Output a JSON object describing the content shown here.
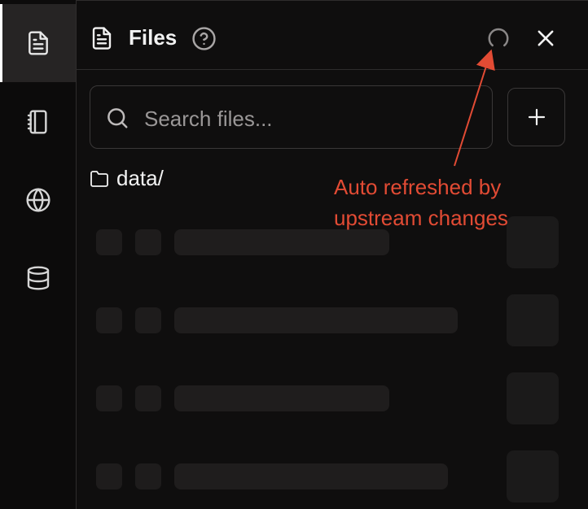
{
  "rail": {
    "items": [
      {
        "name": "files",
        "icon": "file-text-icon",
        "active": true
      },
      {
        "name": "notebook",
        "icon": "notebook-icon",
        "active": false
      },
      {
        "name": "web",
        "icon": "globe-icon",
        "active": false
      },
      {
        "name": "database",
        "icon": "database-icon",
        "active": false
      }
    ]
  },
  "panel": {
    "title": "Files",
    "search_placeholder": "Search files...",
    "add_label": "+",
    "folder_name": "data/"
  },
  "annotation": {
    "text": "Auto refreshed by\nupstream changes",
    "color": "#e24b34"
  },
  "colors": {
    "background": "#0f0e0e",
    "skeleton": "#1f1d1d",
    "border": "#2e2c2c"
  }
}
